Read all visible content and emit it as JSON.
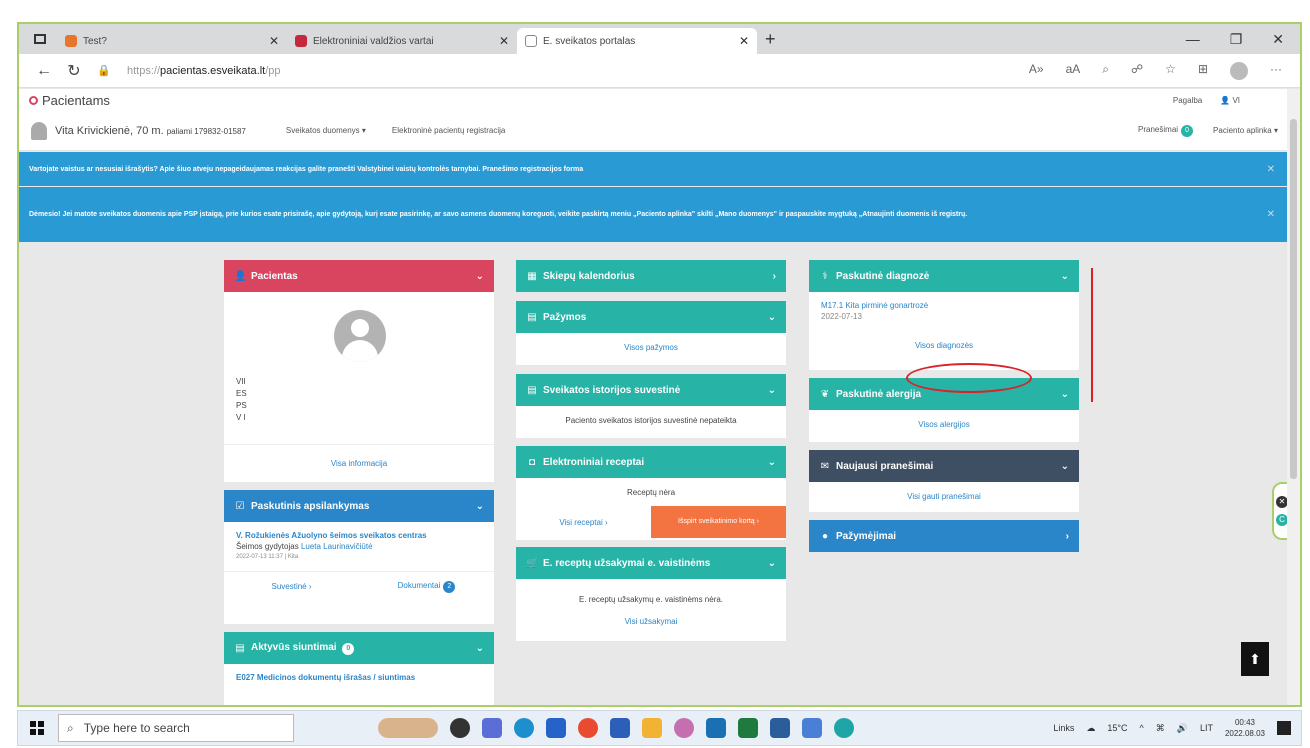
{
  "browser": {
    "tabs": [
      {
        "label": "Test?",
        "color": "#e8742e"
      },
      {
        "label": "Elektroniniai valdžios vartai",
        "color": "#c5283d"
      },
      {
        "label": "E. sveikatos portalas",
        "color": "#888888"
      }
    ],
    "url_prefix": "https://",
    "url_host": "pacientas.esveikata.lt",
    "url_path": "/pp"
  },
  "portal": {
    "logo": "Pacientams",
    "help": "Pagalba",
    "user_short": "VI",
    "patient_name": "Vita Krivickienė, 70 m.",
    "patient_id": "paliami 179832-01587",
    "menu_health_data": "Sveikatos duomenys ▾",
    "menu_registration": "Elektroninė pacientų registracija",
    "messages": "Pranešimai",
    "messages_count": "0",
    "patient_window": "Paciento aplinka ▾"
  },
  "alerts": {
    "first": "Vartojate vaistus ar nesusiai išrašytis? Apie šiuo atveju nepageidaujamas reakcijas galite pranešti Valstybinei vaistų kontrolės tarnybai. Pranešimo registracijos forma",
    "second": "Dėmesio! Jei matote sveikatos duomenis apie PSP įstaigą, prie kurios esate prisirašę, apie gydytoją, kurį esate pasirinkę, ar savo asmens duomenų koreguoti, veikite paskirtą meniu „Paciento aplinka\" skilti „Mano duomenys\" ir paspauskite mygtuką „Atnaujinti duomenis iš registrų."
  },
  "cards": {
    "patient": {
      "title": "Pacientas",
      "lines": [
        "VII",
        "ES",
        "PS",
        "V I"
      ],
      "link": "Visa informacija"
    },
    "last_visit": {
      "title": "Paskutinis apsilankymas",
      "institution": "V. Rožukienės Ažuolyno šeimos sveikatos centras",
      "doctor_label": "Šeimos gydytojas",
      "doctor": "Lueta Laurinavičiūtė",
      "datetime": "2022-07-13 11:37  |  Kita",
      "summary": "Suvestinė ›",
      "documents": "Dokumentai",
      "documents_count": "2"
    },
    "referrals": {
      "title": "Aktyvūs siuntimai",
      "count": "0",
      "item": "E027 Medicinos dokumentų išrašas / siuntimas"
    },
    "calendar": {
      "title": "Skiepų kalendorius"
    },
    "certificates": {
      "title": "Pažymos",
      "link": "Visos pažymos"
    },
    "health_history": {
      "title": "Sveikatos istorijos suvestinė",
      "text": "Paciento sveikatos istorijos suvestinė nepateikta"
    },
    "prescriptions": {
      "title": "Elektroniniai receptai",
      "text": "Receptų nėra",
      "link": "Visi receptai ›",
      "button": "Išspirt sveikatinimo kortą ›"
    },
    "rx_orders": {
      "title": "E. receptų užsakymai e. vaistinėms",
      "text": "E. receptų užsakymų e. vaistinėms nėra.",
      "link": "Visi užsakymai"
    },
    "diagnosis": {
      "title": "Paskutinė diagnozė",
      "code": "M17.1 Kita pirminė gonartrozė",
      "date": "2022-07-13",
      "link": "Visos diagnozės"
    },
    "allergy": {
      "title": "Paskutinė alergija",
      "link": "Visos alergijos"
    },
    "messages": {
      "title": "Naujausi pranešimai",
      "link": "Visi gauti pranešimai"
    },
    "notes": {
      "title": "Pažymėjimai"
    }
  },
  "taskbar": {
    "search_placeholder": "Type here to search",
    "links": "Links",
    "weather": "15°C",
    "lang": "LIT",
    "time": "00:43",
    "date": "2022.08.03"
  }
}
